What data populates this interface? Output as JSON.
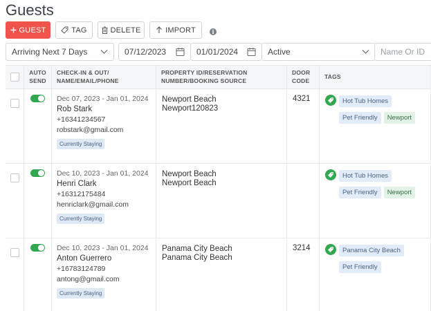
{
  "page": {
    "title": "Guests"
  },
  "toolbar": {
    "guest_label": "GUEST",
    "tag_label": "TAG",
    "delete_label": "DELETE",
    "import_label": "IMPORT"
  },
  "filters": {
    "arrival": "Arriving Next 7 Days",
    "date_from": "07/12/2023",
    "date_to": "01/01/2024",
    "status": "Active",
    "search_placeholder": "Name Or ID"
  },
  "columns": {
    "auto_send": "AUTO SEND",
    "guest_info": "CHECK-IN & OUT/ NAME/EMAIL/PHONE",
    "property": "PROPERTY ID/RESERVATION NUMBER/BOOKING SOURCE",
    "door_code": "DOOR CODE",
    "tags": "TAGS"
  },
  "rows": [
    {
      "dates": "Dec 07, 2023 - Jan 01, 2024",
      "name": "Rob Stark",
      "phone": "+16341234567",
      "email": "robstark@gmail.com",
      "status": "Currently Staying",
      "property": "Newport Beach",
      "reservation": "Newport120823",
      "door_code": "4321",
      "auto_send": true,
      "tags": [
        {
          "label": "Hot Tub Homes",
          "color": "blue"
        },
        {
          "label": "Pet Friendly",
          "color": "blue"
        },
        {
          "label": "Newport",
          "color": "green"
        }
      ]
    },
    {
      "dates": "Dec 10, 2023 - Jan 01, 2024",
      "name": "Henri Clark",
      "phone": "+16312175484",
      "email": "henriclark@gmail.com",
      "status": "Currently Staying",
      "property": "Newport Beach",
      "reservation": "Newport Beach",
      "door_code": "",
      "auto_send": true,
      "tags": [
        {
          "label": "Hot Tub Homes",
          "color": "blue"
        },
        {
          "label": "Pet Friendly",
          "color": "blue"
        },
        {
          "label": "Newport",
          "color": "green"
        }
      ]
    },
    {
      "dates": "Dec 10, 2023 - Jan 01, 2024",
      "name": "Anton Guerrero",
      "phone": "+16783124789",
      "email": "antong@gmail.com",
      "status": "Currently Staying",
      "property": "Panama City Beach",
      "reservation": "Panama City Beach",
      "door_code": "3214",
      "auto_send": true,
      "tags": [
        {
          "label": "Panama City Beach",
          "color": "blue"
        },
        {
          "label": "Pet Friendly",
          "color": "blue"
        }
      ]
    }
  ],
  "colors": {
    "primary": "#f0524c",
    "toggle_on": "#2fa84f",
    "tag_blue_bg": "#e2ecf8",
    "tag_green_bg": "#e2f2e6"
  }
}
